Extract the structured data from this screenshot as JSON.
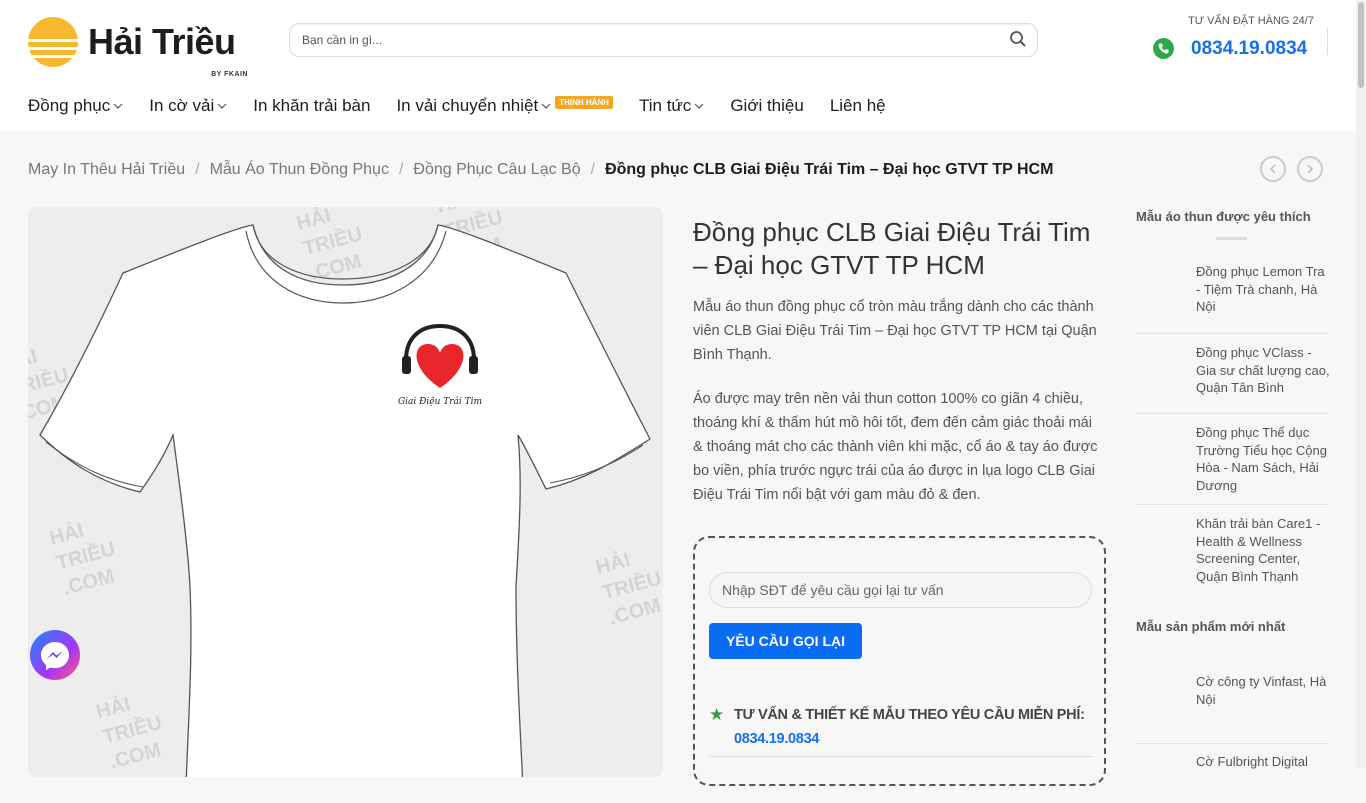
{
  "header": {
    "logo_text": "Hải Triều",
    "logo_sub": "BY FKAIN",
    "search_placeholder": "Bạn cần in gì...",
    "hotline_label": "TƯ VẤN ĐẶT HÀNG 24/7",
    "hotline_number": "0834.19.0834"
  },
  "nav": [
    {
      "label": "Đồng phục",
      "dropdown": true
    },
    {
      "label": "In cờ vải",
      "dropdown": true
    },
    {
      "label": "In khăn trải bàn",
      "dropdown": false
    },
    {
      "label": "In vải chuyển nhiệt",
      "dropdown": true,
      "badge": "THỊNH HÀNH"
    },
    {
      "label": "Tin tức",
      "dropdown": true
    },
    {
      "label": "Giới thiệu",
      "dropdown": false
    },
    {
      "label": "Liên hệ",
      "dropdown": false
    }
  ],
  "breadcrumb": {
    "items": [
      "May In Thêu Hải Triều",
      "Mẫu Áo Thun Đồng Phục",
      "Đồng Phục Câu Lạc Bộ"
    ],
    "separator": "/",
    "current": "Đồng phục CLB Giai Điệu Trái Tim – Đại học GTVT TP HCM"
  },
  "product": {
    "title": "Đồng phục CLB Giai Điệu Trái Tim – Đại học GTVT TP HCM",
    "desc1": "Mẫu áo thun đồng phục cổ tròn màu trắng dành cho các thành viên CLB Giai Điệu Trái Tim – Đại học GTVT TP HCM tại Quận Bình Thạnh.",
    "desc2": "Áo được may trên nền vải thun cotton 100% co giãn 4 chiều, thoáng khí & thấm hút mồ hôi tốt, đem đến cảm giác thoải mái & thoáng mát cho các thành viên khi mặc, cổ áo & tay áo được bo viền, phía trước ngực trái của áo được in lụa logo CLB Giai Điệu Trái Tim nổi bật với gam màu đỏ & đen.",
    "shirt_logo_text": "Giai Điệu Trái Tim",
    "watermark_text": [
      "HẢI",
      "TRIỀU",
      ".COM"
    ]
  },
  "callback": {
    "input_placeholder": "Nhập SĐT để yêu cầu gọi lại tư vấn",
    "button_label": "YÊU CẦU GỌI LẠI",
    "feature_text": "TƯ VẤN & THIẾT KẾ MẪU THEO YÊU CẦU MIỄN PHÍ:",
    "feature_phone": "0834.19.0834"
  },
  "sidebar": {
    "popular_title": "Mẫu áo thun được yêu thích",
    "popular": [
      "Đồng phục Lemon Tra - Tiệm Trà chanh, Hà Nội",
      "Đồng phục VClass - Gia sư chất lượng cao, Quận Tân Bình",
      "Đồng phục Thể dục Trường Tiểu học Cộng Hòa - Nam Sách, Hải Dương",
      "Khăn trải bàn Care1 - Health & Wellness Screening Center, Quận Bình Thạnh"
    ],
    "new_title": "Mẫu sản phẩm mới nhất",
    "new": [
      "Cờ công ty Vinfast, Hà Nội",
      "Cờ Fulbright Digital"
    ]
  },
  "colors": {
    "accent_blue": "#0a6cf2",
    "hotline_blue": "#1572e6",
    "logo_yellow": "#f5b82e",
    "badge_orange": "#f5a623",
    "heart_red": "#e8262b"
  },
  "icons": {
    "search": "search-icon",
    "phone": "whatsapp-phone-icon",
    "chevron": "chevron-down-icon",
    "prev": "chevron-left-icon",
    "next": "chevron-right-icon",
    "star": "star-icon",
    "messenger": "messenger-icon"
  }
}
